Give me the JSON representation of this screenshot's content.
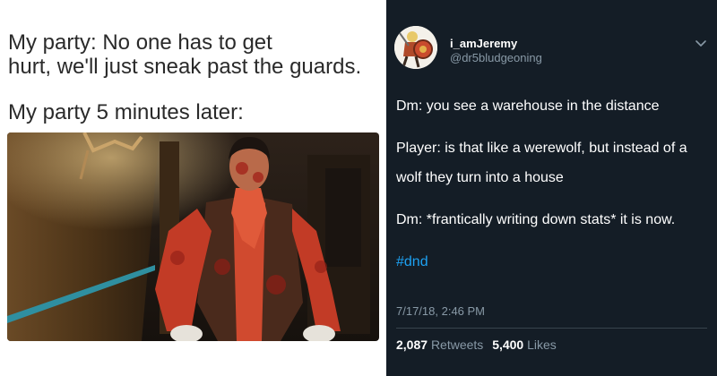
{
  "meme": {
    "setup_line1": "My party: No one has to get",
    "setup_line2": "hurt, we'll just sneak past the guards.",
    "caption": "My party 5 minutes later:"
  },
  "tweet": {
    "display_name": "i_amJeremy",
    "handle": "@dr5bludgeoning",
    "lines": [
      "Dm: you see a warehouse in the distance",
      "Player: is that like a werewolf, but instead of a wolf they turn into a house",
      "Dm: *frantically writing down stats* it is now."
    ],
    "hashtag": "#dnd",
    "timestamp": "7/17/18, 2:46 PM",
    "retweets_count": "2,087",
    "retweets_label": "Retweets",
    "likes_count": "5,400",
    "likes_label": "Likes",
    "menu_icon": "chevron-down-icon",
    "colors": {
      "background": "#141d26",
      "link": "#1da1f2",
      "muted": "#8899a6"
    }
  }
}
